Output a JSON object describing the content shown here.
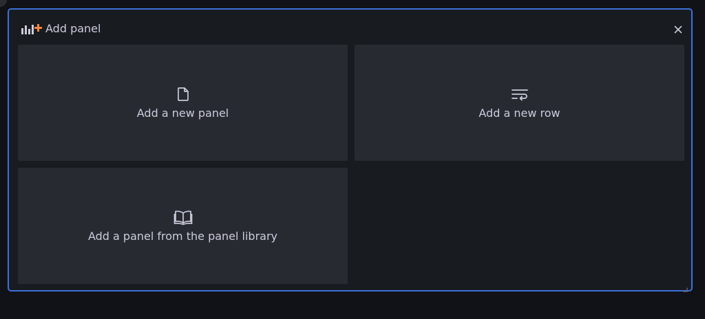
{
  "panel": {
    "title": "Add panel",
    "header_icon": "add-panel-icon",
    "close_icon": "close-icon"
  },
  "options": [
    {
      "label": "Add a new panel",
      "icon": "file-blank-icon"
    },
    {
      "label": "Add a new row",
      "icon": "wrap-text-icon"
    },
    {
      "label": "Add a panel from the panel library",
      "icon": "book-open-icon"
    }
  ],
  "colors": {
    "page_background": "#111217",
    "panel_background": "#181b1f",
    "panel_border": "#3d71d9",
    "tile_background": "#272a31",
    "text": "#ccccdc",
    "accent_plus": "#f5873b"
  }
}
